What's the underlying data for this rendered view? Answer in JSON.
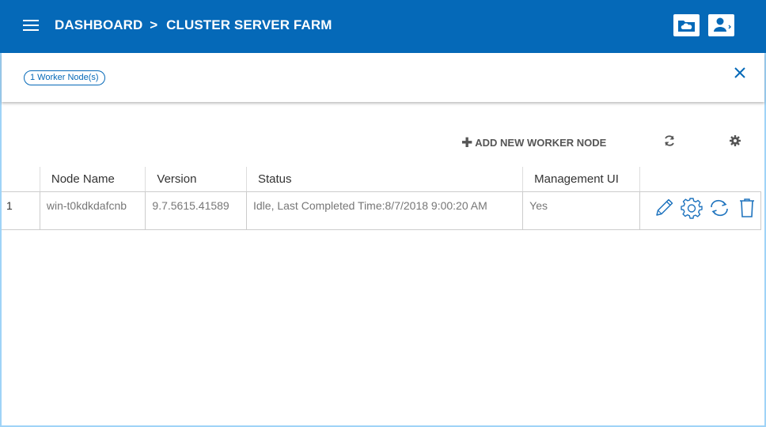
{
  "header": {
    "breadcrumb_root": "DASHBOARD",
    "breadcrumb_separator": ">",
    "breadcrumb_current": "CLUSTER SERVER FARM",
    "menu_icon": "hamburger-menu-icon",
    "cloud_folder_icon": "cloud-folder-icon",
    "user_logout_icon": "user-logout-icon",
    "background_color": "#0569b8"
  },
  "subbar": {
    "badge": "1 Worker Node(s)",
    "close_icon": "close-icon"
  },
  "toolbar": {
    "add_label": "ADD NEW WORKER NODE",
    "add_icon": "plus-icon",
    "refresh_icon": "refresh-icon",
    "settings_icon": "gear-icon"
  },
  "table": {
    "columns": [
      "",
      "Node Name",
      "Version",
      "Status",
      "Management UI",
      ""
    ],
    "rows": [
      {
        "index": "1",
        "node_name": "win-t0kdkdafcnb",
        "version": "9.7.5615.41589",
        "status": "Idle, Last Completed Time:8/7/2018 9:00:20 AM",
        "management_ui": "Yes",
        "actions": [
          "edit-icon",
          "gear-icon",
          "sync-icon",
          "delete-icon"
        ]
      }
    ]
  },
  "colors": {
    "accent": "#0569b8",
    "icon_blue": "#1e73be"
  }
}
